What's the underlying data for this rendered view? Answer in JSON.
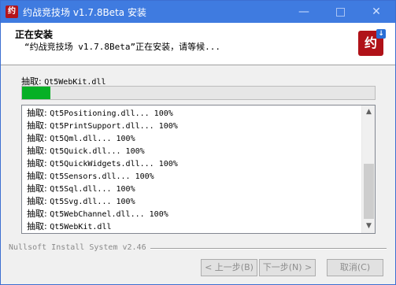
{
  "window": {
    "title": "约战竞技场 v1.7.8Beta 安装",
    "icon": "app-icon",
    "minimize": "—",
    "close": "✕"
  },
  "header": {
    "title": "正在安装",
    "subtitle": "“约战竞技场 v1.7.8Beta”正在安装，请等候...",
    "logo_text": "约"
  },
  "status": {
    "prefix": "抽取:",
    "file": "Qt5WebKit.dll"
  },
  "progress": {
    "percent": 8,
    "color": "#06b025"
  },
  "log": {
    "rows": [
      {
        "prefix": "抽取:",
        "text": "Qt5Positioning.dll... 100%"
      },
      {
        "prefix": "抽取:",
        "text": "Qt5PrintSupport.dll... 100%"
      },
      {
        "prefix": "抽取:",
        "text": "Qt5Qml.dll... 100%"
      },
      {
        "prefix": "抽取:",
        "text": "Qt5Quick.dll... 100%"
      },
      {
        "prefix": "抽取:",
        "text": "Qt5QuickWidgets.dll... 100%"
      },
      {
        "prefix": "抽取:",
        "text": "Qt5Sensors.dll... 100%"
      },
      {
        "prefix": "抽取:",
        "text": "Qt5Sql.dll... 100%"
      },
      {
        "prefix": "抽取:",
        "text": "Qt5Svg.dll... 100%"
      },
      {
        "prefix": "抽取:",
        "text": "Qt5WebChannel.dll... 100%"
      },
      {
        "prefix": "抽取:",
        "text": "Qt5WebKit.dll"
      }
    ],
    "scroll_up": "▲",
    "scroll_down": "▼"
  },
  "footer": {
    "branding": "Nullsoft Install System v2.46",
    "back_label": "< 上一步(B)",
    "next_label": "下一步(N) >",
    "cancel_label": "取消(C)"
  }
}
